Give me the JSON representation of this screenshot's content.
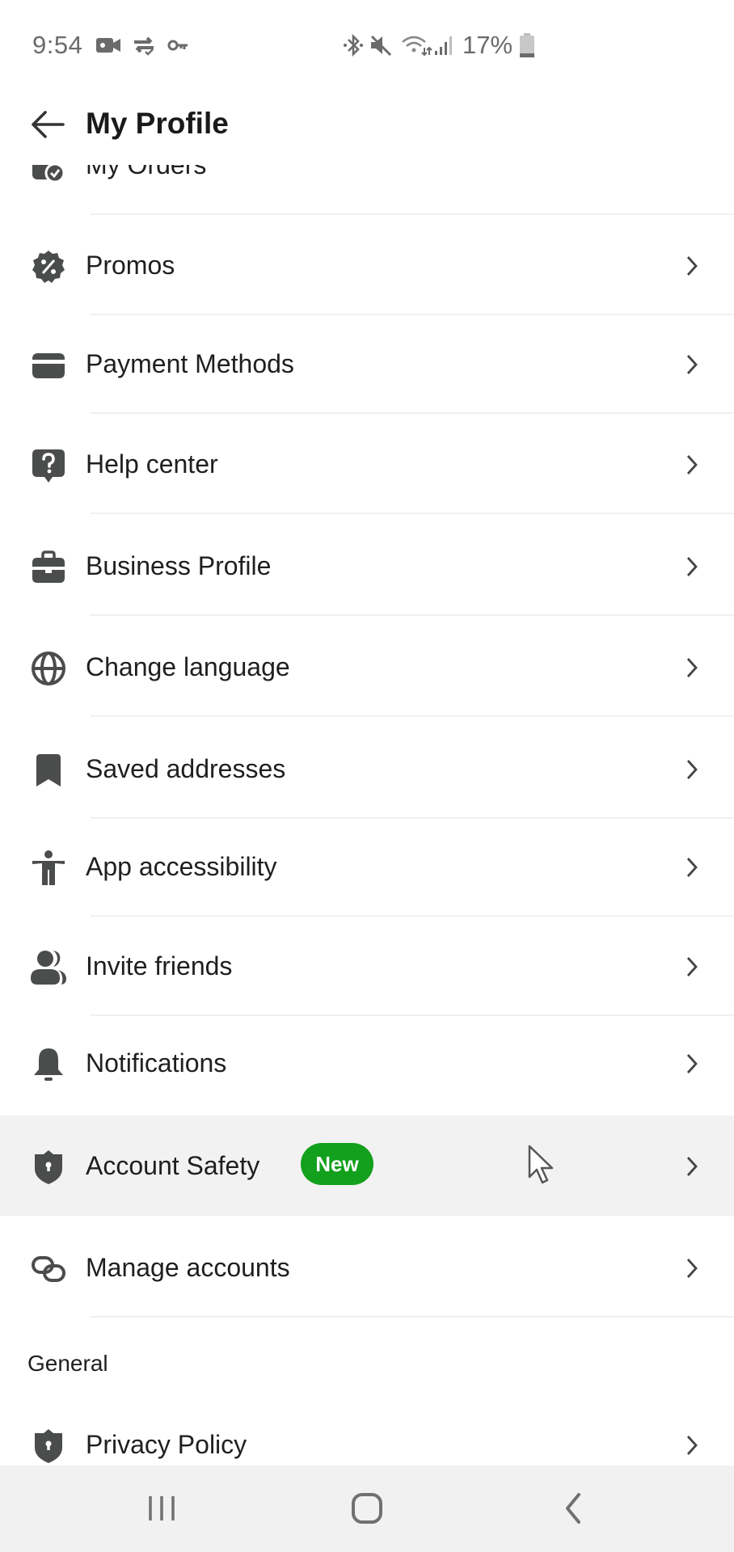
{
  "status_bar": {
    "time": "9:54",
    "battery_percent": "17%",
    "left_icons": [
      "video-camera-icon",
      "sync-check-icon",
      "key-icon"
    ],
    "right_icons": [
      "bluetooth-icon",
      "mute-icon",
      "wifi-icon",
      "signal-icon",
      "battery-icon"
    ]
  },
  "header": {
    "back_icon": "arrow-left-icon",
    "title": "My Profile"
  },
  "menu": {
    "partial_item": {
      "label": "My Orders",
      "icon": "orders-icon"
    },
    "items": [
      {
        "label": "Promos",
        "icon": "promo-badge-icon"
      },
      {
        "label": "Payment Methods",
        "icon": "credit-card-icon"
      },
      {
        "label": "Help center",
        "icon": "help-bubble-icon"
      },
      {
        "label": "Business Profile",
        "icon": "briefcase-icon"
      },
      {
        "label": "Change language",
        "icon": "globe-icon"
      },
      {
        "label": "Saved addresses",
        "icon": "bookmark-icon"
      },
      {
        "label": "App accessibility",
        "icon": "accessibility-icon"
      },
      {
        "label": "Invite friends",
        "icon": "users-icon"
      },
      {
        "label": "Notifications",
        "icon": "bell-icon"
      },
      {
        "label": "Account Safety",
        "icon": "shield-icon",
        "badge": "New",
        "highlighted": true
      },
      {
        "label": "Manage accounts",
        "icon": "link-icon"
      }
    ],
    "general_section": {
      "title": "General",
      "items": [
        {
          "label": "Privacy Policy",
          "icon": "shield-icon"
        }
      ]
    }
  },
  "colors": {
    "badge_green": "#13a01c",
    "icon_gray": "#4a4d4b",
    "highlight_bg": "#f2f2f2",
    "navbar_bg": "#f1f1f1"
  },
  "nav_bar": {
    "buttons": [
      "recent-apps",
      "home",
      "back"
    ]
  }
}
